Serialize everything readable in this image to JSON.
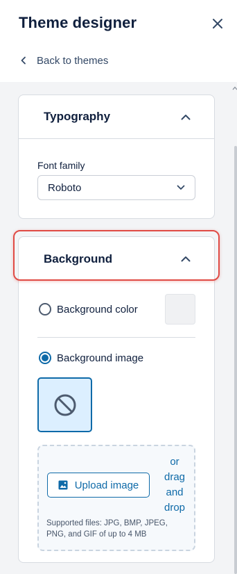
{
  "header": {
    "title": "Theme designer",
    "back_label": "Back to themes"
  },
  "typography": {
    "title": "Typography",
    "font_family_label": "Font family",
    "font_family_value": "Roboto"
  },
  "background": {
    "title": "Background",
    "color_option_label": "Background color",
    "color_option_selected": false,
    "color_value": "#f0f1f3",
    "image_option_label": "Background image",
    "image_option_selected": true,
    "upload_label": "Upload image",
    "drag_words": [
      "or",
      "drag",
      "and",
      "drop"
    ],
    "supported_text": "Supported files: JPG, BMP, JPEG, PNG, and GIF of up to 4 MB"
  },
  "icons": {
    "close": "close-icon",
    "back": "chevron-left-icon",
    "collapse": "chevron-up-icon",
    "dropdown": "chevron-down-icon",
    "no_image": "no-image-icon",
    "upload": "image-icon"
  },
  "colors": {
    "accent": "#0e6aa8",
    "highlight": "#e04b45",
    "text": "#0f1f3d"
  }
}
